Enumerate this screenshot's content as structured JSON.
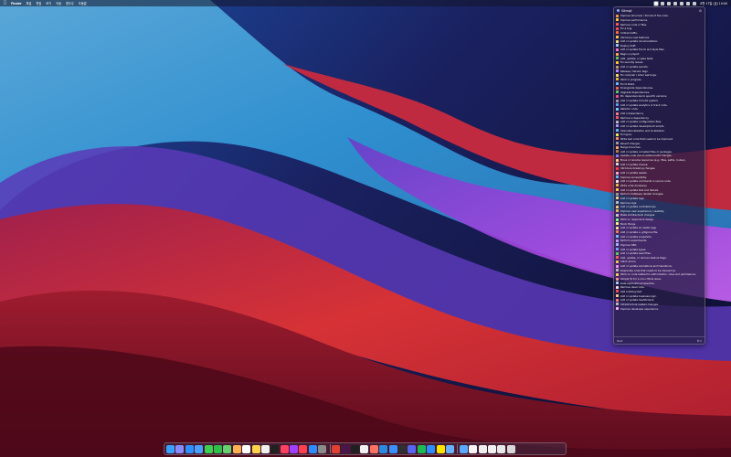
{
  "colors": {
    "accent": "#5a9cff",
    "panel_bg": "#2a1e4a",
    "wallpaper_red": "#d0303a",
    "wallpaper_blue": "#2d9fd8",
    "wallpaper_purple": "#8d3fd0"
  },
  "menubar": {
    "apple_icon": "apple-logo-icon",
    "app_name": "Finder",
    "menus": [
      "파일",
      "편집",
      "보기",
      "이동",
      "윈도우",
      "도움말"
    ],
    "clock": "8월 17일 (금) 10:00"
  },
  "panel": {
    "title": "Gitmoji",
    "gear_icon": "gear-icon",
    "items": [
      {
        "label": "Improve structure / format of the code.",
        "color": "#f0a040"
      },
      {
        "label": "Improve performance.",
        "color": "#ffcc33"
      },
      {
        "label": "Remove code or files.",
        "color": "#ff6060"
      },
      {
        "label": "Fix a bug.",
        "color": "#ff5050"
      },
      {
        "label": "Critical hotfix.",
        "color": "#ff7030"
      },
      {
        "label": "Introduce new features.",
        "color": "#ffd24a"
      },
      {
        "label": "Add or update documentation.",
        "color": "#f0e080"
      },
      {
        "label": "Deploy stuff.",
        "color": "#9ad0ff"
      },
      {
        "label": "Add or update the UI and style files.",
        "color": "#ff77cc"
      },
      {
        "label": "Begin a project.",
        "color": "#ffb347"
      },
      {
        "label": "Add, update, or pass tests.",
        "color": "#60d060"
      },
      {
        "label": "Fix security issues.",
        "color": "#ffcc33"
      },
      {
        "label": "Add or update secrets.",
        "color": "#d0a060"
      },
      {
        "label": "Release / Version tags.",
        "color": "#b090ff"
      },
      {
        "label": "Fix compiler / linter warnings.",
        "color": "#ffe060"
      },
      {
        "label": "Work in progress.",
        "color": "#f0c040"
      },
      {
        "label": "Fix CI Build.",
        "color": "#70c0ff"
      },
      {
        "label": "Downgrade dependencies.",
        "color": "#ff6060"
      },
      {
        "label": "Upgrade dependencies.",
        "color": "#60d060"
      },
      {
        "label": "Pin dependencies to specific versions.",
        "color": "#ff5080"
      },
      {
        "label": "Add or update CI build system.",
        "color": "#a0a0a0"
      },
      {
        "label": "Add or update analytics or track code.",
        "color": "#60a0ff"
      },
      {
        "label": "Refactor code.",
        "color": "#80d0ff"
      },
      {
        "label": "Add a dependency.",
        "color": "#ff8080"
      },
      {
        "label": "Remove a dependency.",
        "color": "#ff6060"
      },
      {
        "label": "Add or update configuration files.",
        "color": "#c0c0c0"
      },
      {
        "label": "Add or update development scripts.",
        "color": "#a0a0ff"
      },
      {
        "label": "Internationalization and localization.",
        "color": "#60c0ff"
      },
      {
        "label": "Fix typos.",
        "color": "#f0f060"
      },
      {
        "label": "Write bad code that needs to be improved.",
        "color": "#ff9060"
      },
      {
        "label": "Revert changes.",
        "color": "#a0a0a0"
      },
      {
        "label": "Merge branches.",
        "color": "#ffb060"
      },
      {
        "label": "Add or update compiled files or packages.",
        "color": "#c08040"
      },
      {
        "label": "Update code due to external API changes.",
        "color": "#8080ff"
      },
      {
        "label": "Move or rename resources (e.g.: files, paths, routes).",
        "color": "#ffd080"
      },
      {
        "label": "Add or update license.",
        "color": "#e0e0e0"
      },
      {
        "label": "Introduce breaking changes.",
        "color": "#ff4040"
      },
      {
        "label": "Add or update assets.",
        "color": "#ffb0d0"
      },
      {
        "label": "Improve accessibility.",
        "color": "#60c0ff"
      },
      {
        "label": "Add or update comments in source code.",
        "color": "#f0f0f0"
      },
      {
        "label": "Write code drunkenly.",
        "color": "#f0c040"
      },
      {
        "label": "Add or update text and literals.",
        "color": "#ffd060"
      },
      {
        "label": "Perform database related changes.",
        "color": "#a0a0a0"
      },
      {
        "label": "Add or update logs.",
        "color": "#ffd080"
      },
      {
        "label": "Remove logs.",
        "color": "#c0c0c0"
      },
      {
        "label": "Add or update contributor(s).",
        "color": "#ffcc80"
      },
      {
        "label": "Improve user experience / usability.",
        "color": "#ffb060"
      },
      {
        "label": "Make architectural changes.",
        "color": "#d0d0d0"
      },
      {
        "label": "Work on responsive design.",
        "color": "#80ff80"
      },
      {
        "label": "Mock things.",
        "color": "#ffff80"
      },
      {
        "label": "Add or update an easter egg.",
        "color": "#ffe0a0"
      },
      {
        "label": "Add or update a .gitignore file.",
        "color": "#ff8040"
      },
      {
        "label": "Add or update snapshots.",
        "color": "#80c0ff"
      },
      {
        "label": "Perform experiments.",
        "color": "#c0a0ff"
      },
      {
        "label": "Improve SEO.",
        "color": "#a0c0ff"
      },
      {
        "label": "Add or update types.",
        "color": "#80a0ff"
      },
      {
        "label": "Add or update seed files.",
        "color": "#60d060"
      },
      {
        "label": "Add, update, or remove feature flags.",
        "color": "#ff6060"
      },
      {
        "label": "Catch errors.",
        "color": "#ffc060"
      },
      {
        "label": "Add or update animations and transitions.",
        "color": "#ff90ff"
      },
      {
        "label": "Deprecate code that needs to be cleaned up.",
        "color": "#c0c0c0"
      },
      {
        "label": "Work on code related to authorization, roles and permissions.",
        "color": "#ffd060"
      },
      {
        "label": "Simple fix for a non-critical issue.",
        "color": "#ff9090"
      },
      {
        "label": "Data exploration/inspection.",
        "color": "#a0d0ff"
      },
      {
        "label": "Remove dead code.",
        "color": "#ffe0e0"
      },
      {
        "label": "Add a failing test.",
        "color": "#ff5050"
      },
      {
        "label": "Add or update business logic.",
        "color": "#ffd080"
      },
      {
        "label": "Add or update healthcheck.",
        "color": "#ff8080"
      },
      {
        "label": "Infrastructure related changes.",
        "color": "#c0c0c0"
      },
      {
        "label": "Improve developer experience.",
        "color": "#ffb0ff"
      }
    ],
    "footer_label": "Quit",
    "footer_shortcut": "⌘Q"
  },
  "dock": {
    "apps": [
      {
        "name": "finder-icon",
        "color": "#3aa0ff"
      },
      {
        "name": "launchpad-icon",
        "color": "#8a8aff"
      },
      {
        "name": "safari-icon",
        "color": "#2e90ff"
      },
      {
        "name": "mail-icon",
        "color": "#4aa0ff"
      },
      {
        "name": "messages-icon",
        "color": "#3ccf50"
      },
      {
        "name": "facetime-icon",
        "color": "#2fbf4a"
      },
      {
        "name": "maps-icon",
        "color": "#66d070"
      },
      {
        "name": "photos-icon",
        "color": "#ffb050"
      },
      {
        "name": "calendar-icon",
        "color": "#ffffff"
      },
      {
        "name": "notes-icon",
        "color": "#ffd24a"
      },
      {
        "name": "reminders-icon",
        "color": "#f0f0f0"
      },
      {
        "name": "tv-icon",
        "color": "#202020"
      },
      {
        "name": "music-icon",
        "color": "#ff4060"
      },
      {
        "name": "podcasts-icon",
        "color": "#a040ff"
      },
      {
        "name": "news-icon",
        "color": "#ff4050"
      },
      {
        "name": "app-store-icon",
        "color": "#2e8cff"
      },
      {
        "name": "system-preferences-icon",
        "color": "#8a8a8a"
      }
    ],
    "extra_apps": [
      {
        "name": "chrome-icon",
        "color": "#e04030"
      },
      {
        "name": "slack-icon",
        "color": "#4a154b"
      },
      {
        "name": "terminal-icon",
        "color": "#202020"
      },
      {
        "name": "notion-icon",
        "color": "#f0f0f0"
      },
      {
        "name": "figma-icon",
        "color": "#ff7262"
      },
      {
        "name": "vscode-icon",
        "color": "#2a8ae0"
      },
      {
        "name": "xcode-icon",
        "color": "#3a90ff"
      },
      {
        "name": "github-icon",
        "color": "#303030"
      },
      {
        "name": "discord-icon",
        "color": "#5865f2"
      },
      {
        "name": "spotify-icon",
        "color": "#1db954"
      },
      {
        "name": "zoom-icon",
        "color": "#2d8cff"
      },
      {
        "name": "kakaotalk-icon",
        "color": "#ffe400"
      },
      {
        "name": "preview-icon",
        "color": "#6ab0ff"
      }
    ],
    "stacks": [
      {
        "name": "downloads-folder-icon",
        "color": "#5aa8ff"
      },
      {
        "name": "document-thumbnail-icon",
        "color": "#f5f5f5"
      },
      {
        "name": "document-thumbnail-icon",
        "color": "#eeeeee"
      },
      {
        "name": "document-thumbnail-icon",
        "color": "#f0f0f0"
      },
      {
        "name": "document-thumbnail-icon",
        "color": "#e8e8e8"
      },
      {
        "name": "trash-icon",
        "color": "#d8d8d8"
      }
    ]
  }
}
